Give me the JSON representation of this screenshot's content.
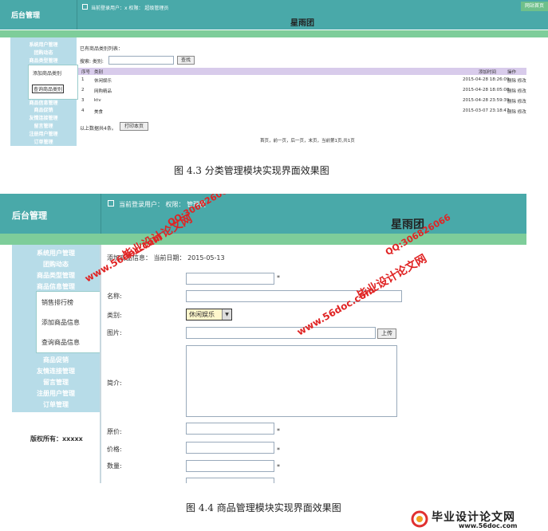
{
  "top_screenshot": {
    "brand": "后台管理",
    "login_info": "当前登录用户：x  权限：  超级管理员",
    "site_title": "星雨团",
    "home_link": "网站首页",
    "sidebar": [
      "系统用户管理",
      "团购动态",
      "商品类型管理",
      "添加商品类别",
      "查询商品类别",
      "商品信息管理",
      "商品促销",
      "友情连接管理",
      "留言管理",
      "注册用户管理",
      "订单管理"
    ],
    "list_title": "已有商品类别列表：",
    "search_label": "搜索: 类别:",
    "search_button": "查找",
    "columns": [
      "序号",
      "类别",
      "添加时间",
      "操作"
    ],
    "rows": [
      {
        "no": "1",
        "name": "休闲娱乐",
        "time": "2015-04-28 18:26:09",
        "ops": "删除 修改"
      },
      {
        "no": "2",
        "name": "网购精品",
        "time": "2015-04-28 18:05:08",
        "ops": "删除 修改"
      },
      {
        "no": "3",
        "name": "ktv",
        "time": "2015-04-28 23:59:39",
        "ops": "删除 修改"
      },
      {
        "no": "4",
        "name": "美食",
        "time": "2015-03-07 23:18:47",
        "ops": "删除 修改"
      }
    ],
    "count_text": "以上数据共4条。",
    "print_button": "打印本页",
    "pager": "首页，前一页，后一页，末页，当前第1页,共1页"
  },
  "caption1": "图 4.3  分类管理模块实现界面效果图",
  "bottom_screenshot": {
    "brand": "后台管理",
    "login_info": "当前登录用户：  权限：  管理员",
    "site_title": "星雨团",
    "sidebar_top": [
      "系统用户管理",
      "团购动态",
      "商品类型管理",
      "商品信息管理"
    ],
    "sidebar_sub": [
      "销售排行榜",
      "添加商品信息",
      "查询商品信息"
    ],
    "sidebar_bottom": [
      "商品促销",
      "友情连接管理",
      "留言管理",
      "注册用户管理",
      "订单管理"
    ],
    "copyright": "版权所有：xxxxx",
    "form_header": "添加商品信息：   当前日期：  2015-05-13",
    "labels": {
      "name": "名称:",
      "type": "类别:",
      "image": "图片:",
      "intro": "简介:",
      "original_price": "原价:",
      "price": "价格:",
      "quantity": "数量:"
    },
    "type_value": "休闲娱乐",
    "upload_button": "上传",
    "required_mark": "*"
  },
  "caption2": "图 4.4  商品管理模块实现界面效果图",
  "watermarks": {
    "site": "www.56doc.com",
    "qq": "QQ:306826066",
    "brand": "毕业设计论文网"
  },
  "footer_logo": {
    "brand": "毕业设计论文网",
    "url": "www.56doc.com"
  }
}
